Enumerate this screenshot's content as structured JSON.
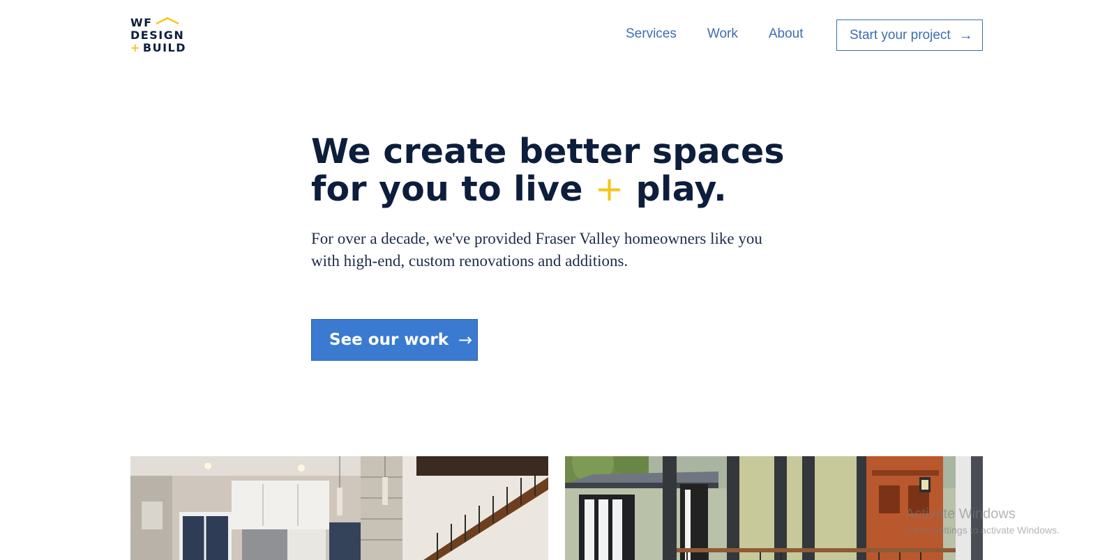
{
  "header": {
    "logo": {
      "line1": "WF",
      "line2": "DESIGN",
      "plus": "+",
      "line3": "BUILD"
    },
    "nav": [
      {
        "label": "Services"
      },
      {
        "label": "Work"
      },
      {
        "label": "About"
      }
    ],
    "cta": {
      "label": "Start your project",
      "arrow": "→"
    }
  },
  "hero": {
    "title_line1": "We create better spaces",
    "title_line2_a": "for you to live ",
    "title_plus": "+",
    "title_line2_b": " play.",
    "subtitle": "For over a decade, we've provided Fraser Valley homeowners like you with high-end, custom renovations and additions.",
    "button": {
      "label": "See our work",
      "arrow": "→"
    }
  },
  "gallery": [
    {
      "name": "kitchen-photo"
    },
    {
      "name": "house-exterior-photo"
    }
  ],
  "watermark": {
    "title": "Activate Windows",
    "subtitle": "Go to Settings to activate Windows."
  },
  "colors": {
    "navy": "#0c1e3c",
    "accent_blue": "#3b7ad1",
    "link_blue": "#3b6db3",
    "yellow": "#f5c518"
  }
}
